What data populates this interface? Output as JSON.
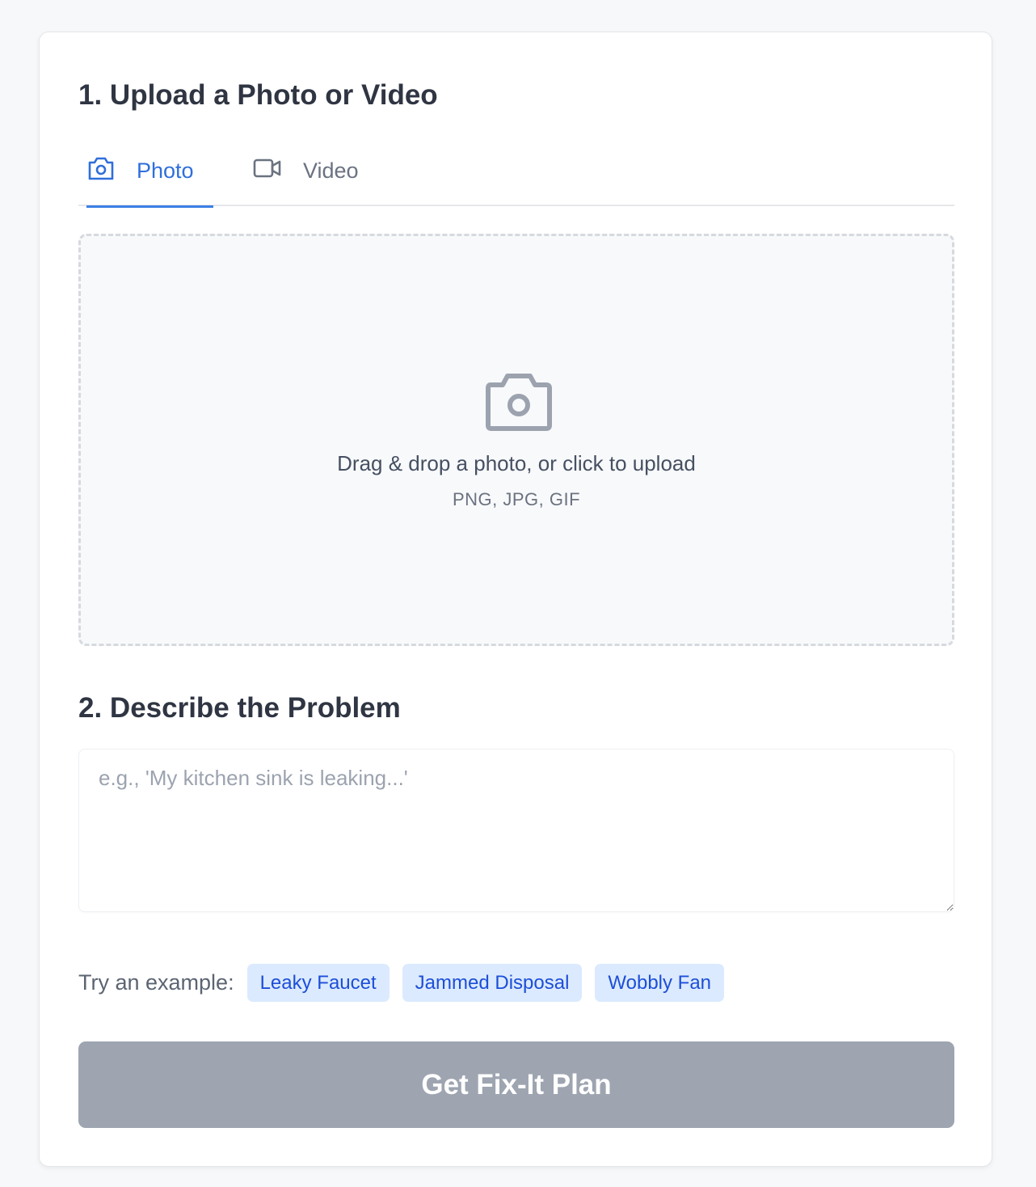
{
  "sections": {
    "upload_title": "1. Upload a Photo or Video",
    "describe_title": "2. Describe the Problem"
  },
  "tabs": [
    {
      "label": "Photo",
      "icon": "camera-icon",
      "active": true
    },
    {
      "label": "Video",
      "icon": "video-icon",
      "active": false
    }
  ],
  "dropzone": {
    "icon": "camera-icon",
    "text": "Drag & drop a photo, or click to upload",
    "formats": "PNG, JPG, GIF"
  },
  "description": {
    "value": "",
    "placeholder": "e.g., 'My kitchen sink is leaking...'"
  },
  "examples": {
    "label": "Try an example:",
    "items": [
      "Leaky Faucet",
      "Jammed Disposal",
      "Wobbly Fan"
    ]
  },
  "submit": {
    "label": "Get Fix-It Plan",
    "disabled": true
  },
  "colors": {
    "accent": "#2f6fdb",
    "chip_bg": "#dbeafe",
    "chip_text": "#1d4ed8",
    "button_disabled": "#9ea5b1",
    "heading": "#2f3542"
  }
}
